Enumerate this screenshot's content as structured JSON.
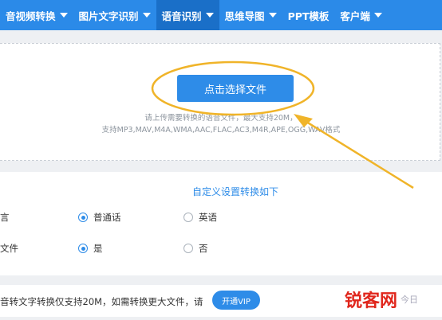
{
  "nav": {
    "items": [
      {
        "label": "音视频转换",
        "dropdown": true,
        "active": false
      },
      {
        "label": "图片文字识别",
        "dropdown": true,
        "active": false
      },
      {
        "label": "语音识别",
        "dropdown": true,
        "active": true
      },
      {
        "label": "思维导图",
        "dropdown": true,
        "active": false
      },
      {
        "label": "PPT模板",
        "dropdown": false,
        "active": false
      },
      {
        "label": "客户端",
        "dropdown": true,
        "active": false
      }
    ]
  },
  "upload": {
    "button_label": "点击选择文件",
    "hint_line1": "请上传需要转换的语音文件，最大支持20M，",
    "hint_line2": "支持MP3,MAV,M4A,WMA,AAC,FLAC,AC3,M4R,APE,OGG,WAV格式"
  },
  "settings": {
    "title": "自定义设置转换如下",
    "language_row": {
      "label": "言",
      "options": [
        {
          "label": "普通话",
          "checked": true
        },
        {
          "label": "英语",
          "checked": false
        }
      ]
    },
    "file_row": {
      "label": "文件",
      "options": [
        {
          "label": "是",
          "checked": true
        },
        {
          "label": "否",
          "checked": false
        }
      ]
    }
  },
  "footer": {
    "notice": "音转文字转换仅支持20M，如需转换更大文件，请",
    "vip_button_label": "开通VIP"
  },
  "watermark": {
    "main": "锐客网",
    "sub": "今日"
  },
  "colors": {
    "nav_bg": "#2b8ae8",
    "nav_active_bg": "#1a6fc8",
    "accent": "#2e8ce8",
    "annotation": "#f0b429",
    "watermark": "#e0261c"
  }
}
